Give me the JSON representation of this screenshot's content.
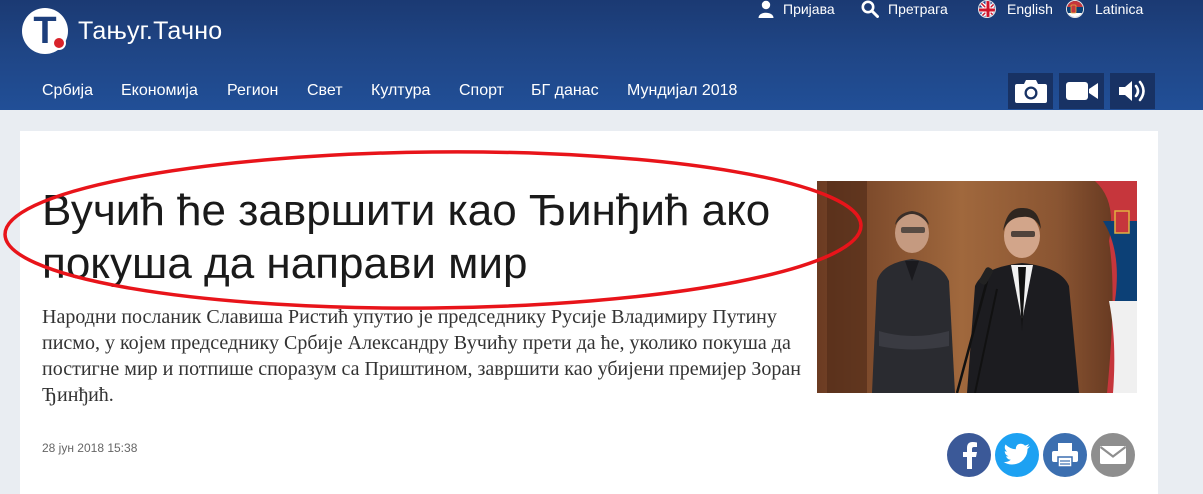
{
  "site": {
    "logo_text": "Тањуг.Тачно",
    "logo_letter": "T"
  },
  "top_links": [
    {
      "label": "Пријава",
      "icon": "user-icon"
    },
    {
      "label": "Претрага",
      "icon": "search-icon"
    },
    {
      "label": "English",
      "icon": "uk-flag-icon"
    },
    {
      "label": "Latinica",
      "icon": "serbia-flag-icon"
    }
  ],
  "nav": [
    {
      "label": "Србија"
    },
    {
      "label": "Економија"
    },
    {
      "label": "Регион"
    },
    {
      "label": "Свет"
    },
    {
      "label": "Култура"
    },
    {
      "label": "Спорт"
    },
    {
      "label": "БГ данас"
    },
    {
      "label": "Мундијал 2018"
    }
  ],
  "media_buttons": [
    "camera-icon",
    "video-icon",
    "audio-icon"
  ],
  "article": {
    "headline": "Вучић ће завршити као Ђинђић ако покуша да направи мир",
    "lead": "Народни посланик Славиша Ристић упутио је председнику Русије Владимиру Путину писмо, у којем председнику Србије Александру Вучићу прети да ће, уколико покуша да постигне мир и потпише споразум са Приштином, завршити као убијени премијер Зоран Ђинђић.",
    "date": "28 јун 2018 15:38"
  },
  "share": [
    "facebook-icon",
    "twitter-icon",
    "print-icon",
    "email-icon"
  ],
  "colors": {
    "header": "#1f4585",
    "annotation_ellipse": "#e8141a",
    "facebook": "#3b5998",
    "twitter": "#1da1f2",
    "print": "#3c6fb0",
    "email": "#8e8e8e"
  }
}
